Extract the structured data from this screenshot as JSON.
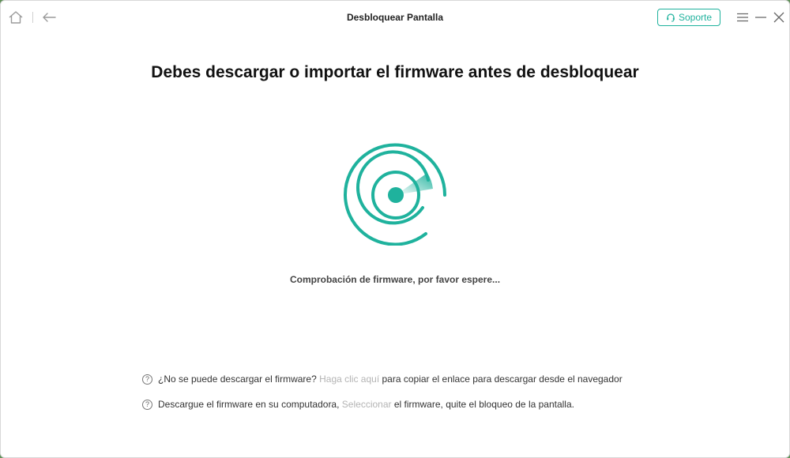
{
  "window": {
    "title": "Desbloquear Pantalla",
    "support_label": "Soporte",
    "icons": [
      "home-icon",
      "back-arrow-icon",
      "headset-icon",
      "menu-icon",
      "minimize-icon",
      "close-icon"
    ]
  },
  "main": {
    "heading": "Debes descargar o importar el firmware antes de desbloquear",
    "status": "Comprobación de firmware, por favor espere...",
    "spinner_color": "#1fb29d"
  },
  "hints": [
    {
      "text_before": "¿No se puede descargar el firmware?",
      "link": "Haga clic aquí",
      "text_after": "para copiar el enlace para descargar desde el navegador"
    },
    {
      "text_before": "Descargue el firmware en su computadora,",
      "link": "Seleccionar",
      "text_after": "el firmware, quite el bloqueo de la pantalla."
    }
  ],
  "colors": {
    "accent": "#1fb29d",
    "link": "#b4b4b4",
    "text": "#333333"
  }
}
